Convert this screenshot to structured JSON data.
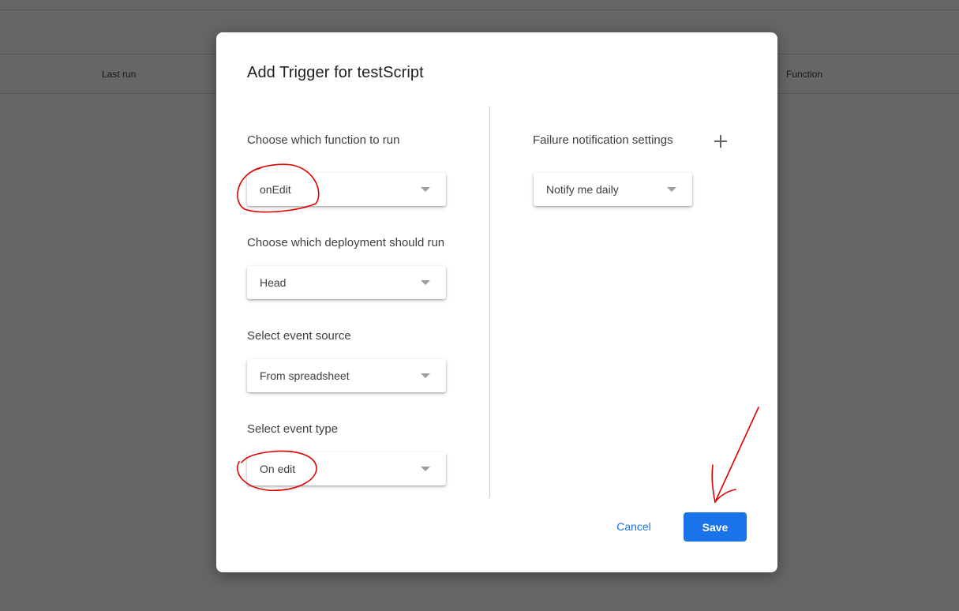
{
  "background": {
    "table_columns": [
      "Last run",
      "Function"
    ]
  },
  "dialog": {
    "title": "Add Trigger for testScript",
    "fields": [
      {
        "label": "Choose which function to run",
        "value": "onEdit"
      },
      {
        "label": "Choose which deployment should run",
        "value": "Head"
      },
      {
        "label": "Select event source",
        "value": "From spreadsheet"
      },
      {
        "label": "Select event type",
        "value": "On edit"
      }
    ],
    "failure": {
      "label": "Failure notification settings",
      "value": "Notify me daily",
      "add_icon": "plus-icon"
    },
    "buttons": {
      "cancel": "Cancel",
      "save": "Save"
    }
  },
  "annotations": {
    "color": "#e00000",
    "items": [
      "circle around onEdit",
      "circle around On edit",
      "arrow pointing to Save"
    ]
  }
}
